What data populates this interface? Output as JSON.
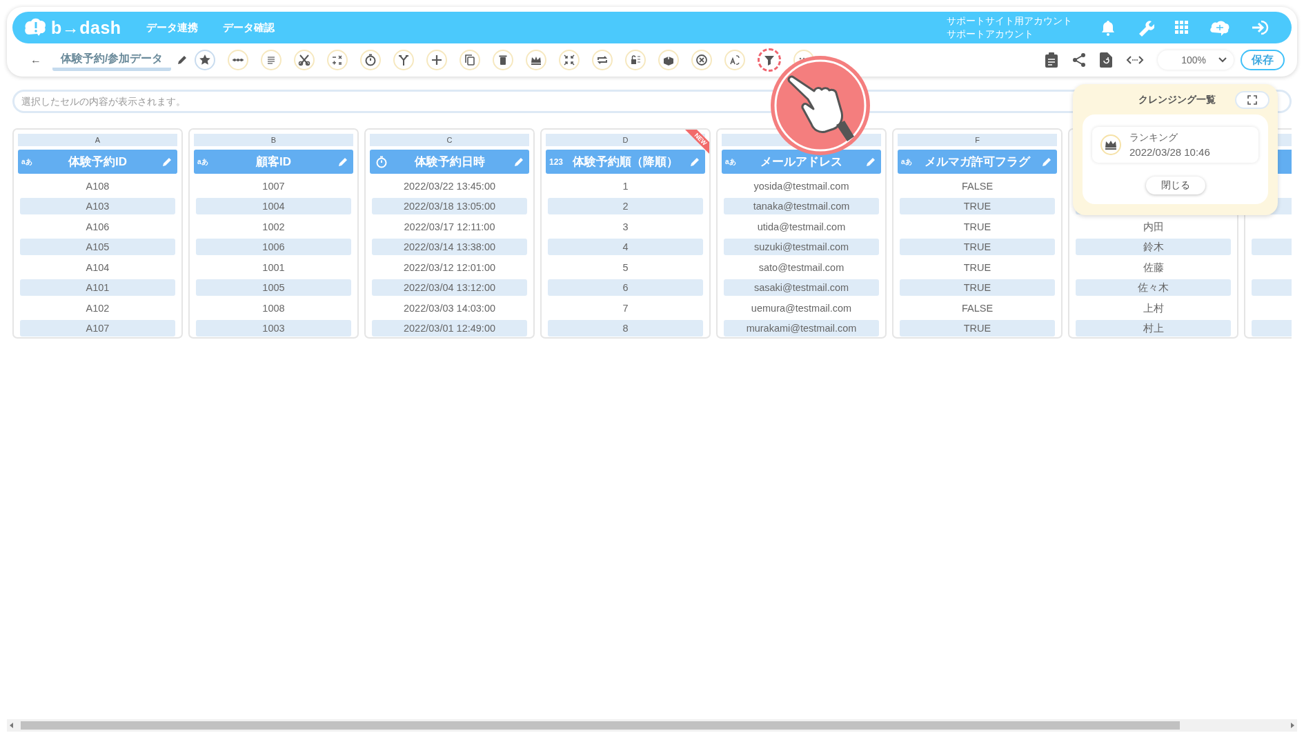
{
  "header": {
    "logo": "b→dash",
    "nav": [
      {
        "label": "データ連携"
      },
      {
        "label": "データ確認"
      }
    ],
    "account": [
      "サポートサイト用アカウント",
      "サポートアカウント"
    ]
  },
  "toolbar": {
    "back": "←",
    "title": "体験予約/参加データ",
    "tools": [
      {
        "selected": false
      },
      {
        "selected": false
      },
      {
        "selected": false
      },
      {
        "selected": false
      },
      {
        "selected": false
      },
      {
        "selected": false
      },
      {
        "selected": false
      },
      {
        "selected": false
      },
      {
        "selected": false
      },
      {
        "selected": false
      },
      {
        "selected": false
      },
      {
        "selected": false
      },
      {
        "selected": false
      },
      {
        "selected": false
      },
      {
        "selected": false
      },
      {
        "selected": false
      },
      {
        "selected": false
      },
      {
        "selected": true
      },
      {
        "selected": false
      }
    ],
    "zoom": "100%",
    "save": "保存"
  },
  "formula_bar": {
    "placeholder": "選択したセルの内容が表示されます。"
  },
  "columns": [
    {
      "letter": "A",
      "kind": "text",
      "type_label": "aあ",
      "title": "体験予約ID",
      "cells": [
        "A108",
        "A103",
        "A106",
        "A105",
        "A104",
        "A101",
        "A102",
        "A107"
      ]
    },
    {
      "letter": "B",
      "kind": "text",
      "type_label": "aあ",
      "title": "顧客ID",
      "cells": [
        "1007",
        "1004",
        "1002",
        "1006",
        "1001",
        "1005",
        "1008",
        "1003"
      ]
    },
    {
      "letter": "C",
      "kind": "datetime",
      "title": "体験予約日時",
      "cells": [
        "2022/03/22 13:45:00",
        "2022/03/18 13:05:00",
        "2022/03/17 12:11:00",
        "2022/03/14 13:38:00",
        "2022/03/12 12:01:00",
        "2022/03/04 13:12:00",
        "2022/03/03 14:03:00",
        "2022/03/01 12:49:00"
      ]
    },
    {
      "letter": "D",
      "kind": "number",
      "type_label": "123",
      "title": "体験予約順（降順）",
      "badge": "NEW",
      "cells": [
        "1",
        "2",
        "3",
        "4",
        "5",
        "6",
        "7",
        "8"
      ]
    },
    {
      "kind": "text",
      "type_label": "aあ",
      "title": "メールアドレス",
      "cells": [
        "yosida@testmail.com",
        "tanaka@testmail.com",
        "utida@testmail.com",
        "suzuki@testmail.com",
        "sato@testmail.com",
        "sasaki@testmail.com",
        "uemura@testmail.com",
        "murakami@testmail.com"
      ]
    },
    {
      "letter": "F",
      "kind": "text",
      "type_label": "aあ",
      "title": "メルマガ許可フラグ",
      "cells": [
        "FALSE",
        "TRUE",
        "TRUE",
        "TRUE",
        "TRUE",
        "TRUE",
        "FALSE",
        "TRUE"
      ]
    },
    {
      "kind": "partial",
      "cells": [
        null,
        null,
        "内田",
        "鈴木",
        "佐藤",
        "佐々木",
        "上村",
        "村上"
      ]
    },
    {
      "kind": "partial"
    }
  ],
  "cleansing_panel": {
    "title": "クレンジング一覧",
    "items": [
      {
        "name": "ランキング",
        "date": "2022/03/28 10:46"
      }
    ],
    "close": "閉じる"
  }
}
